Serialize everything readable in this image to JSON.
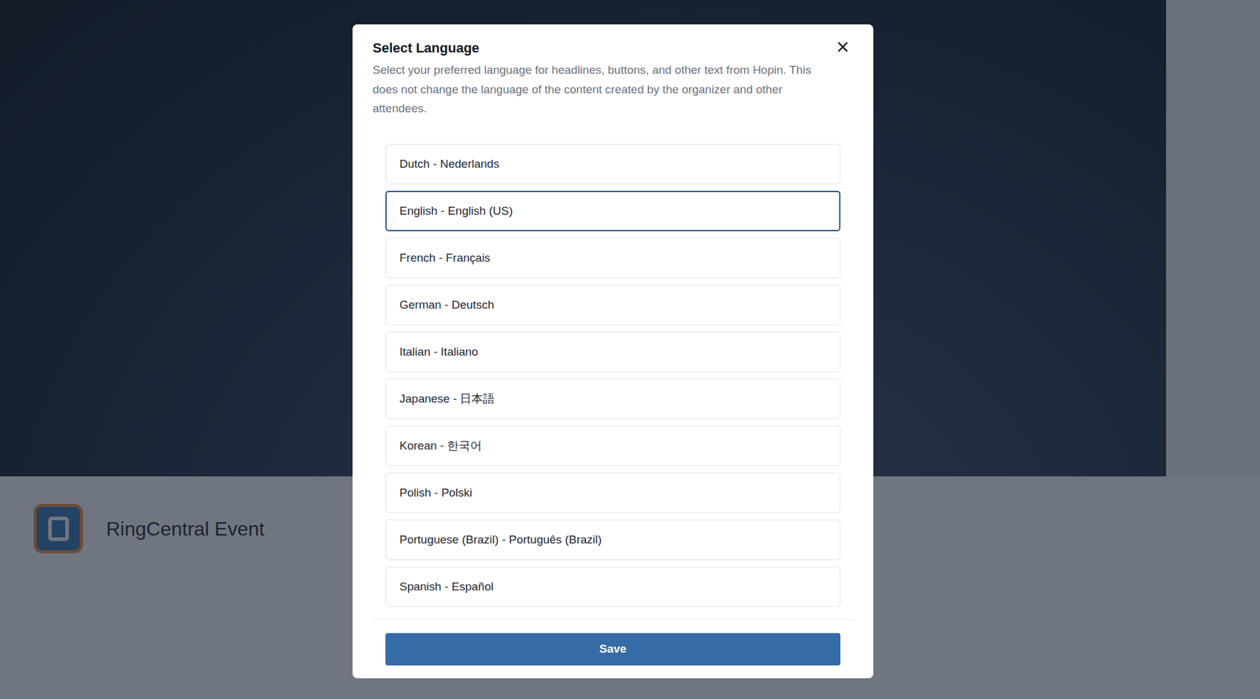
{
  "background": {
    "event_title": "RingCentral Event"
  },
  "dialog": {
    "title": "Select Language",
    "description": "Select your preferred language for headlines, buttons, and other text from Hopin. This does not change the language of the content created by the organizer and other attendees.",
    "languages": [
      {
        "label": "Dutch - Nederlands",
        "selected": false
      },
      {
        "label": "English - English (US)",
        "selected": true
      },
      {
        "label": "French - Français",
        "selected": false
      },
      {
        "label": "German - Deutsch",
        "selected": false
      },
      {
        "label": "Italian - Italiano",
        "selected": false
      },
      {
        "label": "Japanese - 日本語",
        "selected": false
      },
      {
        "label": "Korean - 한국어",
        "selected": false
      },
      {
        "label": "Polish - Polski",
        "selected": false
      },
      {
        "label": "Portuguese (Brazil) - Português (Brazil)",
        "selected": false
      },
      {
        "label": "Spanish - Español",
        "selected": false
      }
    ],
    "buttons": [
      "Save"
    ]
  }
}
